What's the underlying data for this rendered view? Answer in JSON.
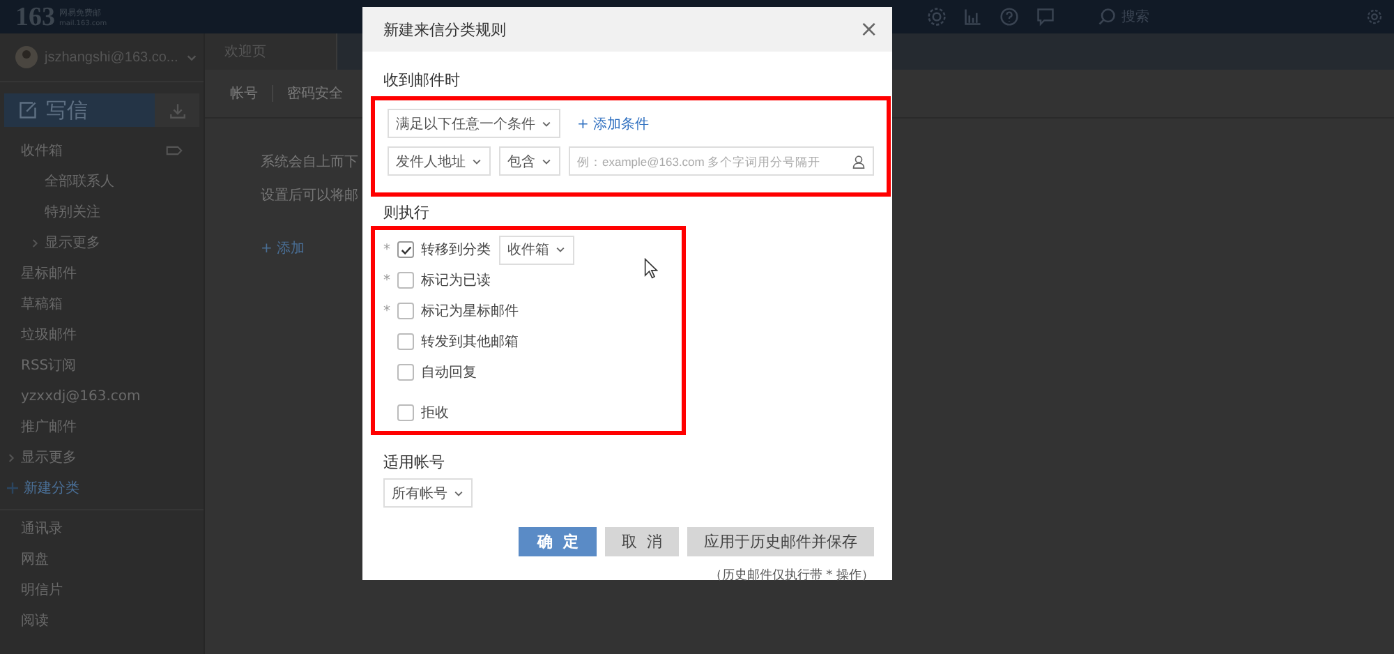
{
  "topbar": {
    "logo": "163",
    "logo_name": "网易免费邮",
    "logo_domain": "mail.163.com",
    "search_label": "搜索"
  },
  "sidebar": {
    "account": "jszhangshi@163.co...",
    "compose": "写信",
    "items": [
      {
        "label": "收件箱",
        "kind": "inbox",
        "children": [
          {
            "label": "全部联系人",
            "kind": "plain"
          },
          {
            "label": "特别关注",
            "kind": "plain"
          },
          {
            "label": "显示更多",
            "kind": "more"
          }
        ]
      },
      {
        "label": "星标邮件",
        "kind": "plain"
      },
      {
        "label": "草稿箱",
        "kind": "plain"
      },
      {
        "label": "垃圾邮件",
        "kind": "plain"
      },
      {
        "label": "RSS订阅",
        "kind": "plain"
      },
      {
        "label": "yzxxdj@163.com",
        "kind": "plain"
      },
      {
        "label": "推广邮件",
        "kind": "plain"
      },
      {
        "label": "显示更多",
        "kind": "more"
      },
      {
        "label": "新建分类",
        "kind": "add"
      }
    ],
    "tools": [
      "通讯录",
      "网盘",
      "明信片",
      "阅读"
    ]
  },
  "main": {
    "tab": "欢迎页",
    "subtabs": [
      "帐号",
      "密码安全"
    ],
    "lines": [
      "系统会自上而下",
      "设置后可以将邮"
    ],
    "add": "+ 添加"
  },
  "dialog": {
    "title": "新建来信分类规则",
    "close": "×",
    "condition_section": {
      "title": "收到邮件时",
      "highlighted": true,
      "match": "满足以下任意一个条件",
      "add_condition": "+ 添加条件",
      "field": "发件人地址",
      "operator": "包含",
      "placeholder": "例：example@163.com 多个字词用分号隔开"
    },
    "action_section": {
      "title": "则执行",
      "highlighted": true,
      "actions": [
        {
          "label": "转移到分类",
          "mark": "*",
          "checked": true,
          "select": "收件箱"
        },
        {
          "label": "标记为已读",
          "mark": "*",
          "checked": false
        },
        {
          "label": "标记为星标邮件",
          "mark": "*",
          "checked": false
        },
        {
          "label": "转发到其他邮箱",
          "checked": false
        },
        {
          "label": "自动回复",
          "checked": false
        },
        {
          "label": "拒收",
          "checked": false
        }
      ]
    },
    "account_section": {
      "title": "适用帐号",
      "select": "所有帐号"
    },
    "buttons": [
      {
        "label": "确  定",
        "kind": "primary"
      },
      {
        "label": "取  消",
        "kind": "secondary"
      },
      {
        "label": "应用于历史邮件并保存",
        "kind": "secondary"
      }
    ],
    "note": "（历史邮件仅执行带 * 操作）"
  }
}
